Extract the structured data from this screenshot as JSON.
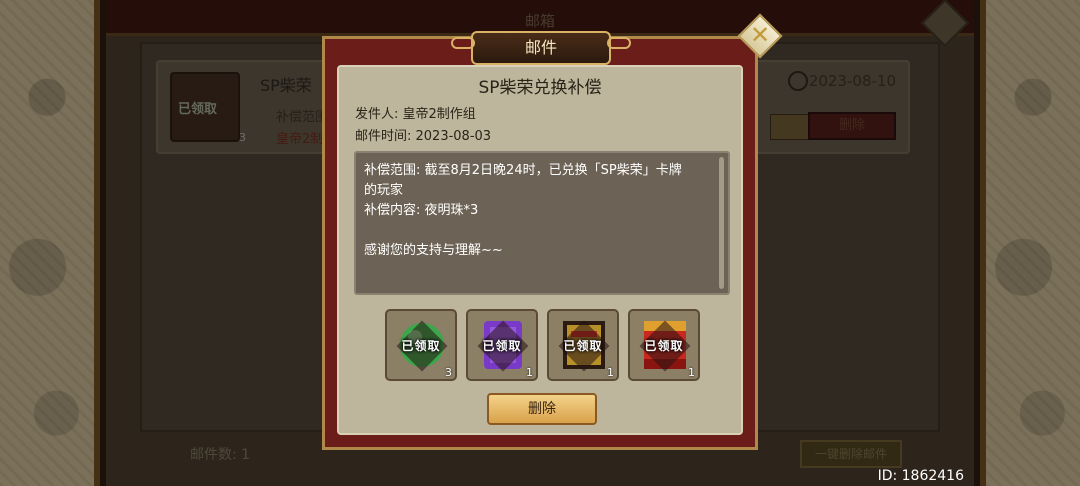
{
  "background": {
    "window_title": "邮箱",
    "mail_item": {
      "subject": "SP柴荣",
      "preview": "补偿范围",
      "sender": "皇帝2制",
      "date": "2023-08-10",
      "stamp": "已领取",
      "count": "3",
      "delete_label": "删除"
    },
    "mail_count_label": "邮件数:  1",
    "delete_all_label": "一键删除邮件"
  },
  "user_id": "ID: 1862416",
  "dialog": {
    "title": "邮件",
    "subject": "SP柴荣兑换补偿",
    "sender": "发件人:  皇帝2制作组",
    "time": "邮件时间:  2023-08-03",
    "body_lines": [
      "补偿范围:  截至8月2日晚24时，已兑换「SP柴荣」卡牌",
      "的玩家",
      "补偿内容:  夜明珠*3",
      "",
      "感谢您的支持与理解~~"
    ],
    "rewards": [
      {
        "stamp": "已领取",
        "count": "3",
        "icon": "night-pearl-icon",
        "color": "#3aa84a"
      },
      {
        "stamp": "已领取",
        "count": "1",
        "icon": "purple-scroll-icon",
        "color": "#7a3ac8"
      },
      {
        "stamp": "已领取",
        "count": "1",
        "icon": "gold-chest-icon",
        "color": "#b8902a"
      },
      {
        "stamp": "已领取",
        "count": "1",
        "icon": "red-card-icon",
        "color": "#c8281e"
      }
    ],
    "delete_label": "删除"
  },
  "colors": {
    "dialog_frame": "#6b1d1a",
    "dialog_panel": "#bdb69d",
    "body_box": "#6c6356",
    "button_gold": "#e0b05a"
  }
}
